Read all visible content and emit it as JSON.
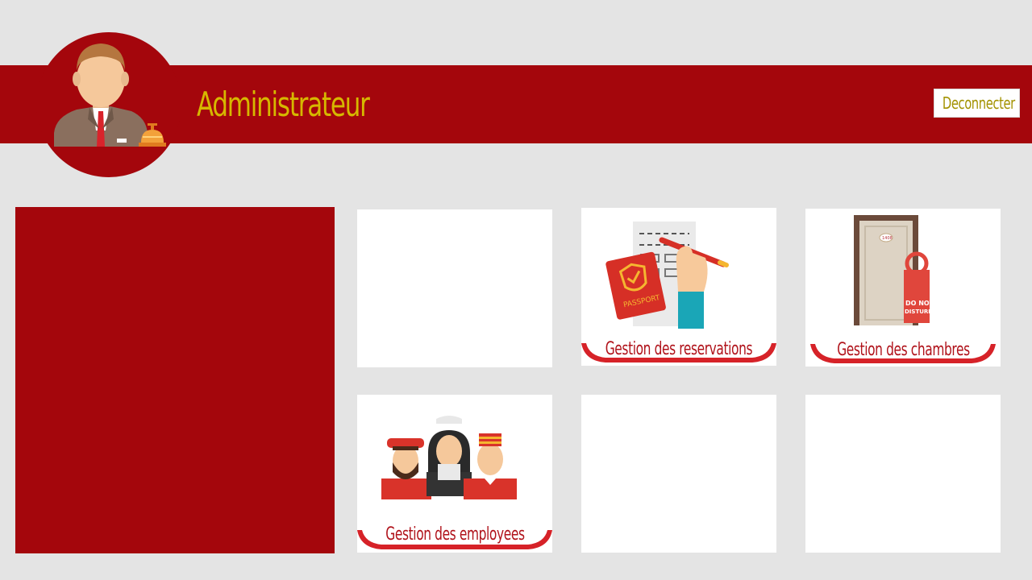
{
  "header": {
    "title": "Administrateur",
    "logout_label": "Deconnecter"
  },
  "tiles": [
    {
      "label": "",
      "icon": "blank"
    },
    {
      "label": "Gestion des reservations",
      "icon": "passport-form-icon"
    },
    {
      "label": "Gestion des chambres",
      "icon": "door-do-not-disturb-icon"
    },
    {
      "label": "Gestion des employees",
      "icon": "hotel-staff-icon"
    },
    {
      "label": "",
      "icon": "blank"
    },
    {
      "label": "",
      "icon": "blank"
    }
  ],
  "art_text": {
    "passport": "PASSPORT",
    "room_number": "1408",
    "hanger_line1": "DO NOT",
    "hanger_line2": "DISTURB"
  },
  "colors": {
    "brand_red": "#a4060c",
    "title_gold": "#d6b800",
    "logout_text": "#a39200",
    "background": "#e4e4e4",
    "tile_label": "#b0121a"
  }
}
